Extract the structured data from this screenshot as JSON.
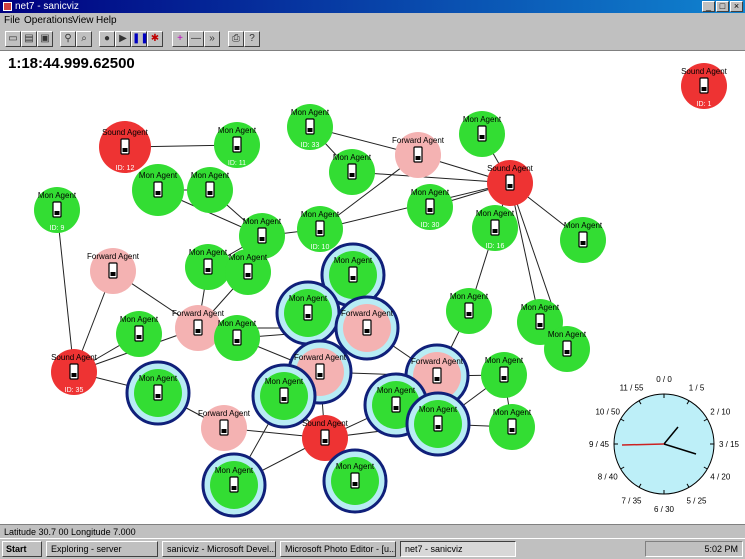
{
  "window": {
    "title": "net7 - sanicviz"
  },
  "menu": [
    "File",
    "Operations",
    "View",
    "Help"
  ],
  "toolbar": [
    "new-icon",
    "open-icon",
    "save-icon",
    "find-icon",
    "zoom-icon",
    "stop-icon",
    "play-icon",
    "pause-icon",
    "debug-icon",
    "add-icon",
    "remove-icon",
    "forward-icon",
    "print-icon",
    "help-icon"
  ],
  "sim_time": "1:18:44.999.62500",
  "colors": {
    "mon": "#33dd33",
    "forward": "#f4b2b2",
    "sound": "#ee3333",
    "halo": "#b8ecf4",
    "clockface": "#bdeff8"
  },
  "nodes": [
    {
      "type": "sound",
      "label": "Sound Agent",
      "id": "ID: 1"
    },
    {
      "type": "sound",
      "label": "Sound Agent",
      "id": "ID: 12"
    },
    {
      "type": "mon",
      "label": "Mon Agent",
      "id": "ID: 11"
    },
    {
      "type": "mon",
      "label": "Mon Agent",
      "id": "ID: 33"
    },
    {
      "type": "forward",
      "label": "Forward Agent",
      "id": ""
    },
    {
      "type": "mon",
      "label": "Mon Agent",
      "id": ""
    },
    {
      "type": "mon",
      "label": "Mon Agent",
      "id": ""
    },
    {
      "type": "sound",
      "label": "Sound Agent",
      "id": ""
    },
    {
      "type": "mon",
      "label": "Mon Agent",
      "id": "ID: 9"
    },
    {
      "type": "mon",
      "label": "Mon Agent",
      "id": ""
    },
    {
      "type": "mon",
      "label": "Mon Agent",
      "id": ""
    },
    {
      "type": "mon",
      "label": "Mon Agent",
      "id": "ID: 30"
    },
    {
      "type": "mon",
      "label": "Mon Agent",
      "id": ""
    },
    {
      "type": "mon",
      "label": "Mon Agent",
      "id": "ID: 10"
    },
    {
      "type": "mon",
      "label": "Mon Agent",
      "id": "ID: 16"
    },
    {
      "type": "mon",
      "label": "Mon Agent",
      "id": ""
    },
    {
      "type": "forward",
      "label": "Forward Agent",
      "id": ""
    },
    {
      "type": "mon",
      "label": "Mon Agent",
      "id": ""
    },
    {
      "type": "mon",
      "label": "Mon Agent",
      "id": ""
    },
    {
      "type": "mon",
      "label": "Mon Agent",
      "id": ""
    },
    {
      "type": "mon",
      "label": "Mon Agent",
      "id": ""
    },
    {
      "type": "forward",
      "label": "Forward Agent",
      "id": ""
    },
    {
      "type": "forward",
      "label": "Forward Agent",
      "id": ""
    },
    {
      "type": "mon",
      "label": "Mon Agent",
      "id": ""
    },
    {
      "type": "mon",
      "label": "Mon Agent",
      "id": ""
    },
    {
      "type": "mon",
      "label": "Mon Agent",
      "id": ""
    },
    {
      "type": "forward",
      "label": "Forward Agent",
      "id": ""
    },
    {
      "type": "sound",
      "label": "Sound Agent",
      "id": "ID: 35"
    },
    {
      "type": "mon",
      "label": "Mon Agent",
      "id": ""
    },
    {
      "type": "forward",
      "label": "Forward Agent",
      "id": ""
    },
    {
      "type": "mon",
      "label": "Mon Agent",
      "id": ""
    },
    {
      "type": "mon",
      "label": "Mon Agent",
      "id": ""
    },
    {
      "type": "mon",
      "label": "Mon Agent",
      "id": ""
    },
    {
      "type": "mon",
      "label": "Mon Agent",
      "id": ""
    },
    {
      "type": "mon",
      "label": "Mon Agent",
      "id": ""
    },
    {
      "type": "forward",
      "label": "Forward Agent",
      "id": ""
    },
    {
      "type": "sound",
      "label": "Sound Agent",
      "id": ""
    },
    {
      "type": "mon",
      "label": "Mon Agent",
      "id": ""
    },
    {
      "type": "mon",
      "label": "Mon Agent",
      "id": ""
    },
    {
      "type": "mon",
      "label": "Mon Agent",
      "id": ""
    },
    {
      "type": "mon",
      "label": "Mon Agent",
      "id": ""
    },
    {
      "type": "mon",
      "label": "Mon Agent",
      "id": ""
    },
    {
      "type": "mon",
      "label": "Mon Agent",
      "id": ""
    }
  ],
  "dial": {
    "labels": [
      "0 / 0",
      "1 / 5",
      "2 / 10",
      "3 / 15",
      "4 / 20",
      "5 / 25",
      "6 / 30",
      "7 / 35",
      "8 / 40",
      "9 / 45",
      "10 / 50",
      "11 / 55"
    ]
  },
  "status": {
    "text": "Latitude 30.7 00 Longitude 7.000"
  },
  "taskbar": {
    "start": "Start",
    "tasks": [
      "Exploring - server",
      "sanicviz - Microsoft Devel...",
      "Microsoft Photo Editor - [u...",
      "net7 - sanicviz"
    ],
    "clock": "5:02 PM"
  }
}
